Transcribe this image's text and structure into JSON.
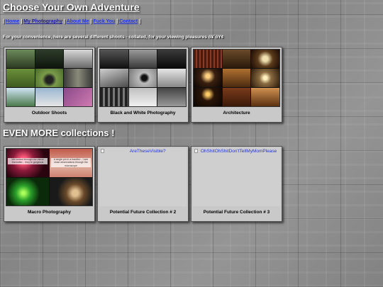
{
  "header": {
    "title": "Choose Your Own Adventure"
  },
  "nav": {
    "sep": "|",
    "links": [
      {
        "label": "Home"
      },
      {
        "label": "My Photography"
      },
      {
        "label": "About Me"
      },
      {
        "label": "Fuck You"
      },
      {
        "label": "Contact"
      }
    ]
  },
  "intro": {
    "text": "For your convenience, here are several different shoots - collated, for your viewing pleasures ö¥´öY¢"
  },
  "more_heading": "EVEN MORE collections !",
  "collections": [
    {
      "caption": "Outdoor Shoots"
    },
    {
      "caption": "Black and White Photography"
    },
    {
      "caption": "Architecture"
    }
  ],
  "more_collections": [
    {
      "caption": "Macro Photography",
      "captions_in_thumb": [
        "We looked through our mirror thereafter... they're gorgeous",
        "A single pin in a handful... I see close observations through the microscope"
      ]
    },
    {
      "caption": "Potential Future Collection # 2",
      "alt_text": "AreTheseVisible?"
    },
    {
      "caption": "Potential Future Collection # 3",
      "alt_text": "OhShitOhShitDon'tTellMyMomPlease"
    }
  ],
  "colors": {
    "link": "#2233dd",
    "card_bg": "#c9c9c9",
    "heading": "#ffffff"
  }
}
